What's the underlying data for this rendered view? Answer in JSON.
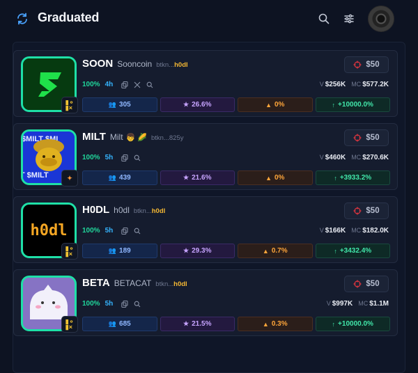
{
  "header": {
    "title": "Graduated"
  },
  "icons": {
    "refresh": "refresh-icon",
    "search": "search-icon",
    "filter": "filter-sliders-icon"
  },
  "colors": {
    "accent_green": "#20d69b",
    "accent_blue": "#35b4ff",
    "card_border": "#1ee0a7"
  },
  "tokens": [
    {
      "symbol": "SOON",
      "name": "Sooncoin",
      "addr_prefix": "btkn...",
      "addr_suffix": "h0dl",
      "buy": "$50",
      "percent": "100%",
      "age": "4h",
      "v_label": "V",
      "volume": "$256K",
      "mc_label": "MC",
      "market_cap": "$577.2K",
      "holders": "305",
      "top10": "26.6%",
      "dev": "0%",
      "change": "+10000.0%"
    },
    {
      "symbol": "MILT",
      "name": "Milt",
      "name_emoji": "👦 🌽",
      "addr_prefix": "btkn...",
      "addr_suffix": "825y",
      "buy": "$50",
      "percent": "100%",
      "age": "5h",
      "v_label": "V",
      "volume": "$460K",
      "mc_label": "MC",
      "market_cap": "$270.6K",
      "holders": "439",
      "top10": "21.6%",
      "dev": "0%",
      "change": "+3933.2%"
    },
    {
      "symbol": "H0DL",
      "name": "h0dl",
      "addr_prefix": "btkn...",
      "addr_suffix": "h0dl",
      "buy": "$50",
      "percent": "100%",
      "age": "5h",
      "v_label": "V",
      "volume": "$166K",
      "mc_label": "MC",
      "market_cap": "$182.0K",
      "holders": "189",
      "top10": "29.3%",
      "dev": "0.7%",
      "change": "+3432.4%",
      "thumb_text": "h0dl"
    },
    {
      "symbol": "BETA",
      "name": "BETACAT",
      "addr_prefix": "btkn...",
      "addr_suffix": "h0dl",
      "buy": "$50",
      "percent": "100%",
      "age": "5h",
      "v_label": "V",
      "volume": "$997K",
      "mc_label": "MC",
      "market_cap": "$1.1M",
      "holders": "685",
      "top10": "21.5%",
      "dev": "0.3%",
      "change": "+10000.0%"
    }
  ],
  "thumb_texts": {
    "milt_banner": "$MILT $MILT"
  }
}
